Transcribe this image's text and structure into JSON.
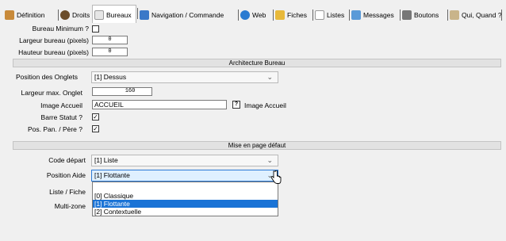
{
  "tabs": [
    {
      "label": "Définition",
      "icon": "definition-icon",
      "color": "#c88a3a"
    },
    {
      "label": "Droits",
      "icon": "user-rights-icon",
      "color": "#6b4d2a"
    },
    {
      "label": "Bureaux",
      "icon": "folder-icon",
      "color": "#e6e6e6"
    },
    {
      "label": "Navigation / Commande",
      "icon": "navigation-icon",
      "color": "#3a78c8"
    },
    {
      "label": "Web",
      "icon": "globe-icon",
      "color": "#2a7bd1"
    },
    {
      "label": "Fiches",
      "icon": "fiche-icon",
      "color": "#e8b93a"
    },
    {
      "label": "Listes",
      "icon": "list-icon",
      "color": "#d9d9d9"
    },
    {
      "label": "Messages",
      "icon": "messages-icon",
      "color": "#5a9ad8"
    },
    {
      "label": "Boutons",
      "icon": "buttons-icon",
      "color": "#777777"
    },
    {
      "label": "Qui, Quand ?",
      "icon": "who-when-icon",
      "color": "#c9b48a"
    }
  ],
  "form": {
    "bureau_minimum": "Bureau Minimum ?",
    "largeur_bureau": "Largeur bureau (pixels)",
    "largeur_bureau_val": "0",
    "hauteur_bureau": "Hauteur bureau (pixels)",
    "hauteur_bureau_val": "0",
    "section_architecture": "Architecture Bureau",
    "position_onglets": "Position des Onglets",
    "position_onglets_val": "[1] Dessus",
    "largeur_onglet": "Largeur max. Onglet",
    "largeur_onglet_val": "160",
    "image_accueil": "Image Accueil",
    "image_accueil_val": "ACCUEIL",
    "image_help": "?",
    "image_accueil_link": "Image Accueil",
    "barre_statut": "Barre Statut ?",
    "pos_pan": "Pos. Pan. / Père ?",
    "section_mise": "Mise en page défaut",
    "code_depart": "Code départ",
    "code_depart_val": "[1] Liste",
    "position_aide": "Position Aide",
    "position_aide_val": "[1] Flottante",
    "liste_fiche": "Liste / Fiche",
    "multizone": "Multi-zone",
    "options": [
      "[0] Classique",
      "[1] Flottante",
      "[2] Contextuelle"
    ],
    "check_mark": "✓",
    "chevron": "⌄"
  }
}
